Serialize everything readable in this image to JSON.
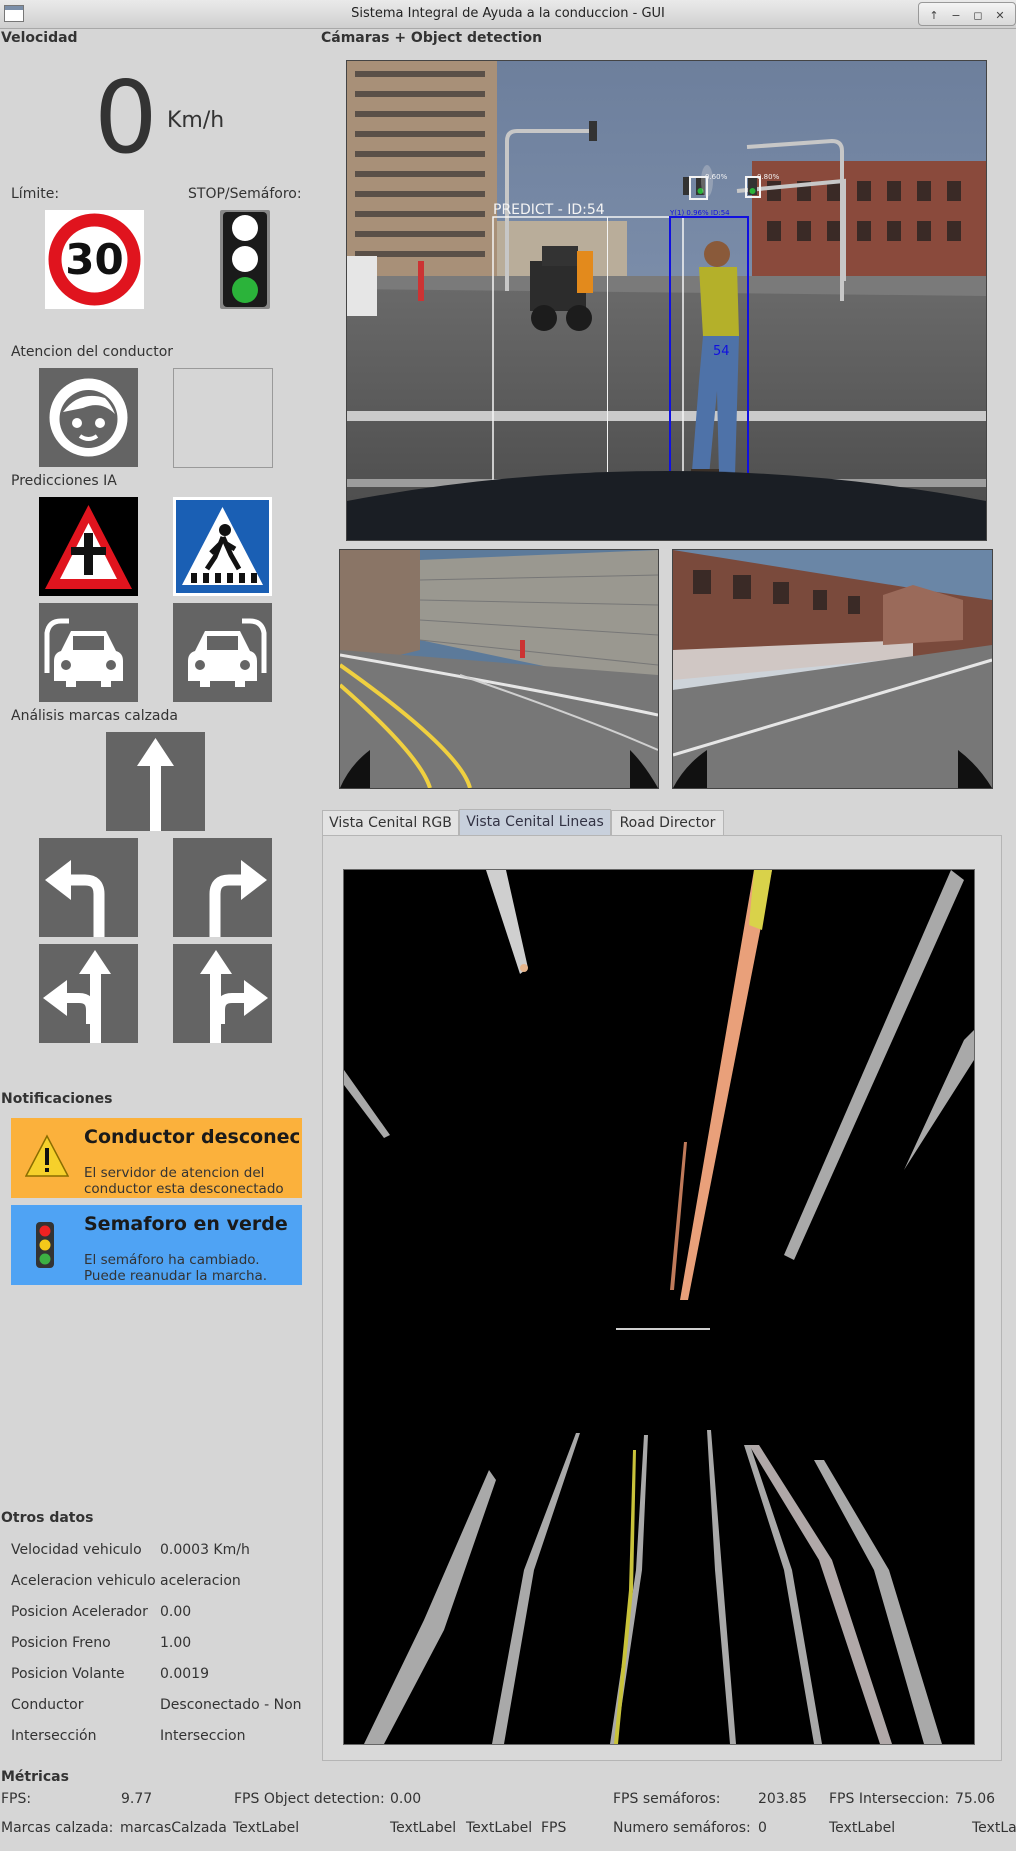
{
  "window": {
    "title": "Sistema Integral de Ayuda a la conduccion - GUI",
    "controls": [
      "↑",
      "−",
      "◻",
      "✕"
    ]
  },
  "velocidad": {
    "header": "Velocidad",
    "value": "0",
    "unit": "Km/h"
  },
  "limite": {
    "label": "Límite:",
    "value": "30"
  },
  "stop": {
    "label": "STOP/Semáforo:",
    "light": "green"
  },
  "atencion": {
    "label": "Atencion del conductor"
  },
  "predicciones": {
    "label": "Predicciones IA"
  },
  "analisis": {
    "label": "Análisis marcas calzada"
  },
  "camaras": {
    "header": "Cámaras + Object detection",
    "detections": {
      "vehicle": "PREDICT - ID:54",
      "pedestrian": "Y(1) 0.96% ID:54",
      "pedestrian_id": "54",
      "light1": "0.60%",
      "light2": "0.80%"
    }
  },
  "tabs": [
    {
      "label": "Vista Cenital RGB",
      "active": false
    },
    {
      "label": "Vista Cenital Lineas",
      "active": true
    },
    {
      "label": "Road Director",
      "active": false
    }
  ],
  "notificaciones": {
    "header": "Notificaciones",
    "items": [
      {
        "title": "Conductor desconectado",
        "line1": "El servidor de atencion del",
        "line2": "conductor esta desconectado",
        "color": "#fbb13c",
        "icon": "warning-icon"
      },
      {
        "title": "Semaforo en verde",
        "line1": "El semáforo ha cambiado.",
        "line2": "Puede reanudar la marcha.",
        "color": "#4fa3f4",
        "icon": "traffic-light-icon"
      }
    ]
  },
  "otros": {
    "header": "Otros datos",
    "rows": [
      {
        "label": "Velocidad vehiculo",
        "value": "0.0003 Km/h"
      },
      {
        "label": "Aceleracion vehiculo",
        "value": "aceleracion"
      },
      {
        "label": "Posicion Acelerador",
        "value": "0.00"
      },
      {
        "label": "Posicion Freno",
        "value": "1.00"
      },
      {
        "label": "Posicion Volante",
        "value": "0.0019"
      },
      {
        "label": "Conductor",
        "value": "Desconectado - Non"
      },
      {
        "label": "Intersección",
        "value": "Interseccion"
      }
    ]
  },
  "metricas": {
    "header": "Métricas",
    "fps_label": "FPS:",
    "fps_value": "9.77",
    "fps_od_label": "FPS Object detection:",
    "fps_od_value": "0.00",
    "fps_sem_label": "FPS semáforos:",
    "fps_sem_value": "203.85",
    "fps_int_label": "FPS Interseccion:",
    "fps_int_value": "75.06",
    "marcas_label": "Marcas calzada:",
    "marcas_value": "marcasCalzada",
    "tl1": "TextLabel",
    "tl2": "TextLabel",
    "tl3": "TextLabel",
    "fps_small": "FPS",
    "num_sem_label": "Numero semáforos:",
    "num_sem_value": "0",
    "tl4": "TextLabel",
    "tl5": "TextLa"
  }
}
